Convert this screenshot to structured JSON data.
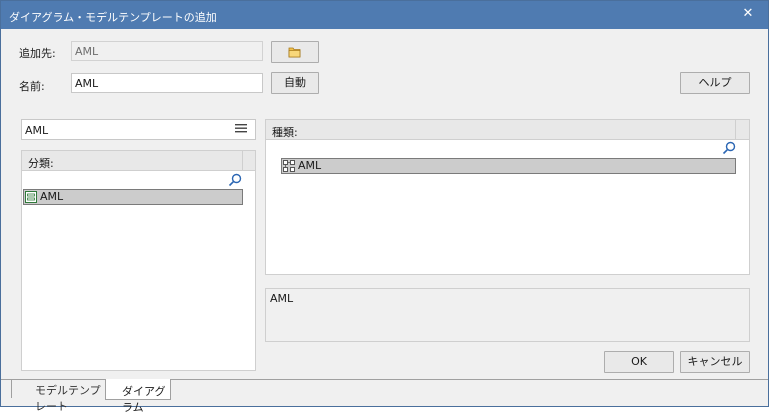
{
  "window": {
    "title": "ダイアグラム・モデルテンプレートの追加",
    "close_glyph": "✕"
  },
  "form": {
    "destination_label": "追加先:",
    "destination_value": "AML",
    "name_label": "名前:",
    "name_value": "AML",
    "auto_label": "自動",
    "help_label": "ヘルプ"
  },
  "filter": {
    "value": "AML"
  },
  "category_panel": {
    "header": "分類:",
    "items": [
      {
        "label": "AML"
      }
    ]
  },
  "type_panel": {
    "header": "種類:",
    "items": [
      {
        "label": "AML"
      }
    ]
  },
  "description": {
    "text": "AML"
  },
  "buttons": {
    "ok": "OK",
    "cancel": "キャンセル"
  },
  "tabs": [
    {
      "label": "モデルテンプレート"
    },
    {
      "label": "ダイアグラム",
      "active": true
    }
  ]
}
